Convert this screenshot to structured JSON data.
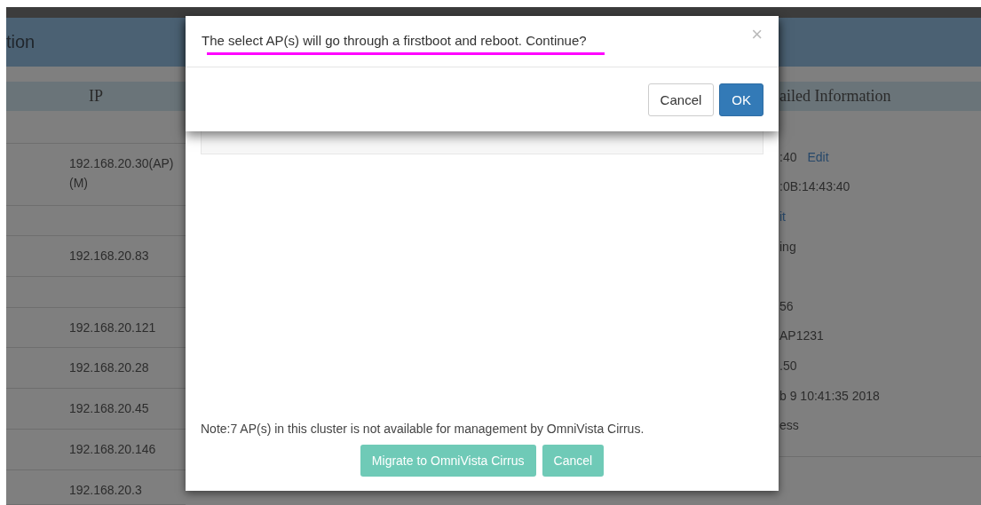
{
  "banner": {
    "title": "tion"
  },
  "table": {
    "columns": [
      "IP"
    ],
    "rows": [
      {},
      {
        "ip": "192.168.20.30(AP)(M)"
      },
      {},
      {
        "ip": "192.168.20.83"
      },
      {},
      {
        "ip": "192.168.20.121"
      },
      {
        "ip": "192.168.20.28"
      },
      {
        "ip": "192.168.20.45"
      },
      {
        "ip": "192.168.20.146"
      },
      {
        "ip": "192.168.20.3"
      }
    ]
  },
  "details": {
    "heading": "ailed Information",
    "rows": [
      {
        "value": ":40",
        "link": "Edit"
      },
      {
        "value": ":0B:14:43:40"
      },
      {
        "link": "it"
      },
      {
        "value": "ing"
      },
      {},
      {
        "value": "56"
      },
      {
        "value": "AP1231"
      },
      {
        "value": ".50"
      },
      {
        "value": "b 9 10:41:35 2018"
      },
      {
        "value": "ess"
      }
    ]
  },
  "migrate_dialog": {
    "note": "Note:7 AP(s) in this cluster is not available for management by OmniVista Cirrus.",
    "buttons": [
      "Migrate to OmniVista Cirrus",
      "Cancel"
    ]
  },
  "confirm_dialog": {
    "message": "The select AP(s) will go through a firstboot and reboot. Continue?",
    "close": "×",
    "buttons": [
      {
        "label": "Cancel",
        "kind": "default"
      },
      {
        "label": "OK",
        "kind": "primary"
      }
    ]
  }
}
